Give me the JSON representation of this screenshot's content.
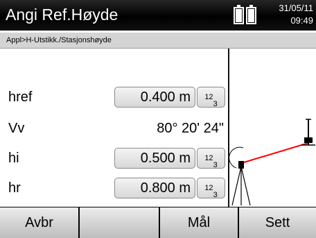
{
  "header": {
    "title": "Angi Ref.Høyde",
    "date": "31/05/11",
    "time": "09:49",
    "battery_icon": "battery-icon"
  },
  "breadcrumb": "Appl>H-Utstikk./Stasjonshøyde",
  "fields": {
    "href": {
      "label": "href",
      "value": "0.400 m"
    },
    "vv": {
      "label": "Vv",
      "value": "80° 20' 24\""
    },
    "hi": {
      "label": "hi",
      "value": "0.500 m"
    },
    "hr": {
      "label": "hr",
      "value": "0.800 m"
    }
  },
  "keypad": {
    "sup": "12",
    "sub": "3"
  },
  "softkeys": {
    "avbr": "Avbr",
    "empty": "",
    "mal": "Mål",
    "sett": "Sett"
  },
  "diagram": {
    "beam_color": "#ff0000",
    "icon": "instrument-beam-diagram"
  }
}
